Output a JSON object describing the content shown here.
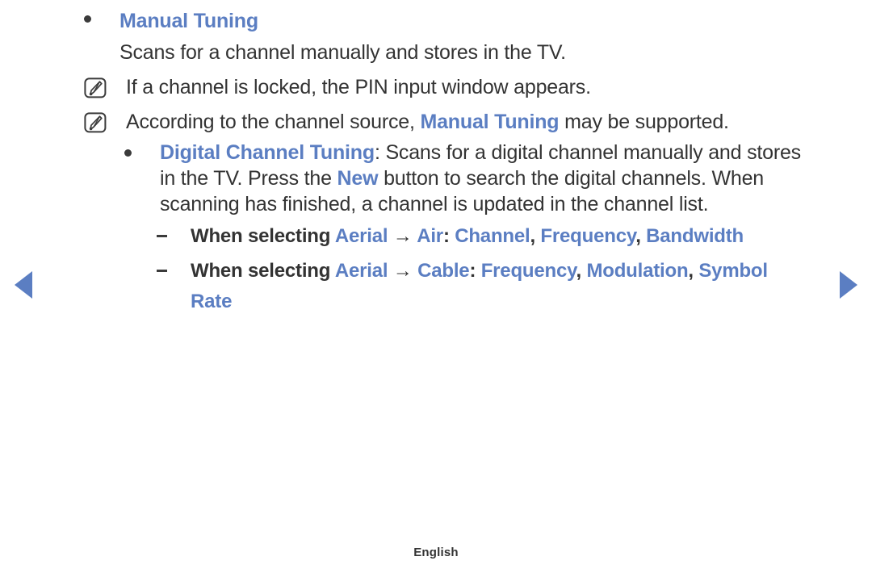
{
  "page": {
    "language_footer": "English"
  },
  "nav": {
    "prev_label": "previous-page",
    "next_label": "next-page"
  },
  "icons": {
    "note": "note-pen-icon",
    "bullet": "bullet-dot-icon",
    "dash": "dash-icon",
    "prev": "triangle-left-icon",
    "next": "triangle-right-icon"
  },
  "colors": {
    "link_blue": "#5b7ec2",
    "body_text": "#333333",
    "background": "#ffffff"
  },
  "sections": {
    "manual_tuning": {
      "title": "Manual Tuning",
      "description": "Scans for a channel manually and stores in the TV.",
      "notes": [
        "If a channel is locked, the PIN input window appears.",
        {
          "prefix": "According to the channel source, ",
          "emphasis": "Manual Tuning",
          "suffix": " may be supported."
        }
      ]
    },
    "digital_channel_tuning": {
      "title": "Digital Channel Tuning",
      "body_part1": ": Scans for a digital channel manually and stores in the TV. Press the ",
      "emphasis_button": "New",
      "body_part2": " button to search the digital channels. When scanning has finished, a channel is updated in the channel list.",
      "options": [
        {
          "lead": "When selecting ",
          "source": "Aerial",
          "arrow": "→",
          "mode": "Air",
          "separator": ": ",
          "fields": [
            "Channel",
            "Frequency",
            "Bandwidth"
          ]
        },
        {
          "lead": "When selecting ",
          "source": "Aerial",
          "arrow": "→",
          "mode": "Cable",
          "separator": ": ",
          "fields": [
            "Frequency",
            "Modulation",
            "Symbol Rate"
          ]
        }
      ]
    }
  }
}
